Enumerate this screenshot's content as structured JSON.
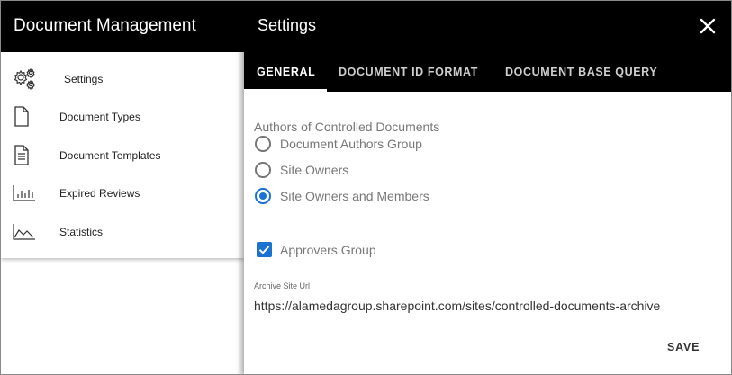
{
  "app": {
    "title": "Document Management"
  },
  "sidebar": {
    "items": [
      {
        "label": "Settings",
        "icon": "gears-icon"
      },
      {
        "label": "Document Types",
        "icon": "document-icon"
      },
      {
        "label": "Document Templates",
        "icon": "document-lines-icon"
      },
      {
        "label": "Expired Reviews",
        "icon": "bar-chart-icon"
      },
      {
        "label": "Statistics",
        "icon": "area-chart-icon"
      }
    ]
  },
  "settings": {
    "title": "Settings",
    "close_icon": "close-icon",
    "tabs": [
      {
        "label": "GENERAL",
        "active": true
      },
      {
        "label": "DOCUMENT ID FORMAT",
        "active": false
      },
      {
        "label": "DOCUMENT BASE QUERY",
        "active": false
      }
    ],
    "authors": {
      "label": "Authors of Controlled Documents",
      "options": [
        {
          "label": "Document Authors Group",
          "checked": false
        },
        {
          "label": "Site Owners",
          "checked": false
        },
        {
          "label": "Site Owners and Members",
          "checked": true
        }
      ]
    },
    "approvers": {
      "label": "Approvers Group",
      "checked": true
    },
    "archive": {
      "label": "Archive Site Url",
      "value": "https://alamedagroup.sharepoint.com/sites/controlled-documents-archive"
    },
    "save_label": "SAVE"
  },
  "colors": {
    "header": "#000000",
    "accent": "#1a73d1"
  }
}
